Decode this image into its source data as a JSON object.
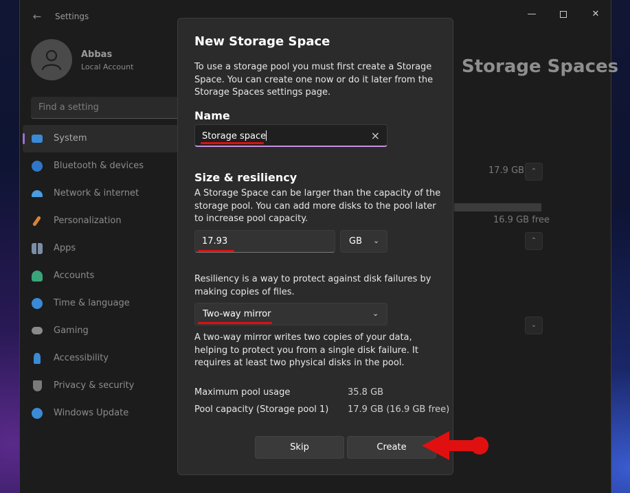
{
  "window": {
    "app_title": "Settings",
    "back_icon": "arrow-left-icon",
    "controls": {
      "minimize": "minimize-icon",
      "maximize": "maximize-icon",
      "close": "close-icon"
    }
  },
  "profile": {
    "name": "Abbas",
    "account_type": "Local Account"
  },
  "search": {
    "placeholder": "Find a setting"
  },
  "sidebar": {
    "items": [
      {
        "label": "System",
        "icon": "monitor-icon",
        "color": "#3a8ad6",
        "active": true
      },
      {
        "label": "Bluetooth & devices",
        "icon": "bluetooth-icon",
        "color": "#2f77c9"
      },
      {
        "label": "Network & internet",
        "icon": "wifi-icon",
        "color": "#4a9de0"
      },
      {
        "label": "Personalization",
        "icon": "brush-icon",
        "color": "#d9823a"
      },
      {
        "label": "Apps",
        "icon": "apps-icon",
        "color": "#7b8ea6"
      },
      {
        "label": "Accounts",
        "icon": "person-icon",
        "color": "#3aa57a"
      },
      {
        "label": "Time & language",
        "icon": "globe-clock-icon",
        "color": "#3a8ad6"
      },
      {
        "label": "Gaming",
        "icon": "gamepad-icon",
        "color": "#8a8a8a"
      },
      {
        "label": "Accessibility",
        "icon": "accessibility-icon",
        "color": "#3a8ad6"
      },
      {
        "label": "Privacy & security",
        "icon": "shield-icon",
        "color": "#7a7a7a"
      },
      {
        "label": "Windows Update",
        "icon": "refresh-icon",
        "color": "#3a8ad6"
      }
    ]
  },
  "background": {
    "page_heading": "Storage Spaces",
    "pool_size": "17.9 GB",
    "free_space": "16.9 GB free"
  },
  "dialog": {
    "title": "New Storage Space",
    "intro": "To use a storage pool you must first create a Storage Space. You can create one now or do it later from the Storage Spaces settings page.",
    "name_heading": "Name",
    "name_value": "Storage space",
    "size_heading": "Size & resiliency",
    "size_desc": "A Storage Space can be larger than the capacity of the storage pool. You can add more disks to the pool later to increase pool capacity.",
    "size_value": "17.93",
    "unit_value": "GB",
    "resiliency_desc": "Resiliency is a way to protect against disk failures by making copies of files.",
    "resiliency_value": "Two-way mirror",
    "mirror_desc": "A two-way mirror writes two copies of your data, helping to protect you from a single disk failure. It requires at least two physical disks in the pool.",
    "max_usage_label": "Maximum pool usage",
    "max_usage_value": "35.8 GB",
    "pool_capacity_label": "Pool capacity (Storage pool 1)",
    "pool_capacity_value": "17.9 GB (16.9 GB free)",
    "skip_label": "Skip",
    "create_label": "Create"
  },
  "annotation_color": "#e01010"
}
